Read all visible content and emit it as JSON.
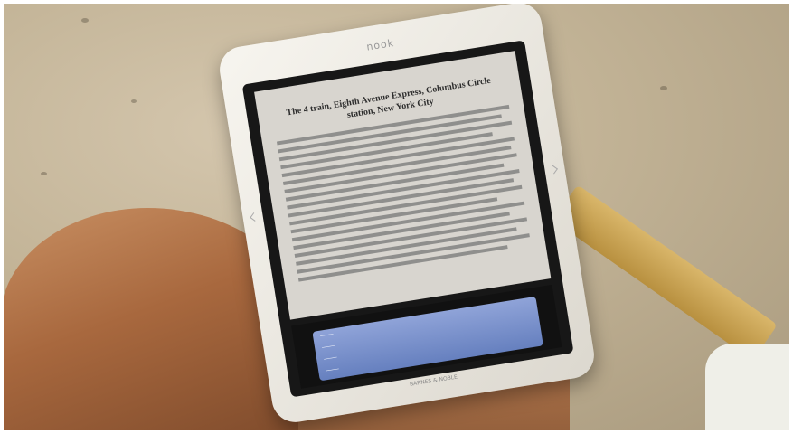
{
  "scene": {
    "description_elements": [
      "sand-background",
      "e-reader",
      "reader-legs",
      "hand",
      "beach-chair",
      "towel"
    ]
  },
  "device": {
    "brand": "nook",
    "screen_title": "The 4 train, Eighth Avenue Express, Columbus Circle station, New York City",
    "manufacturer": "BARNES & NOBLE"
  }
}
